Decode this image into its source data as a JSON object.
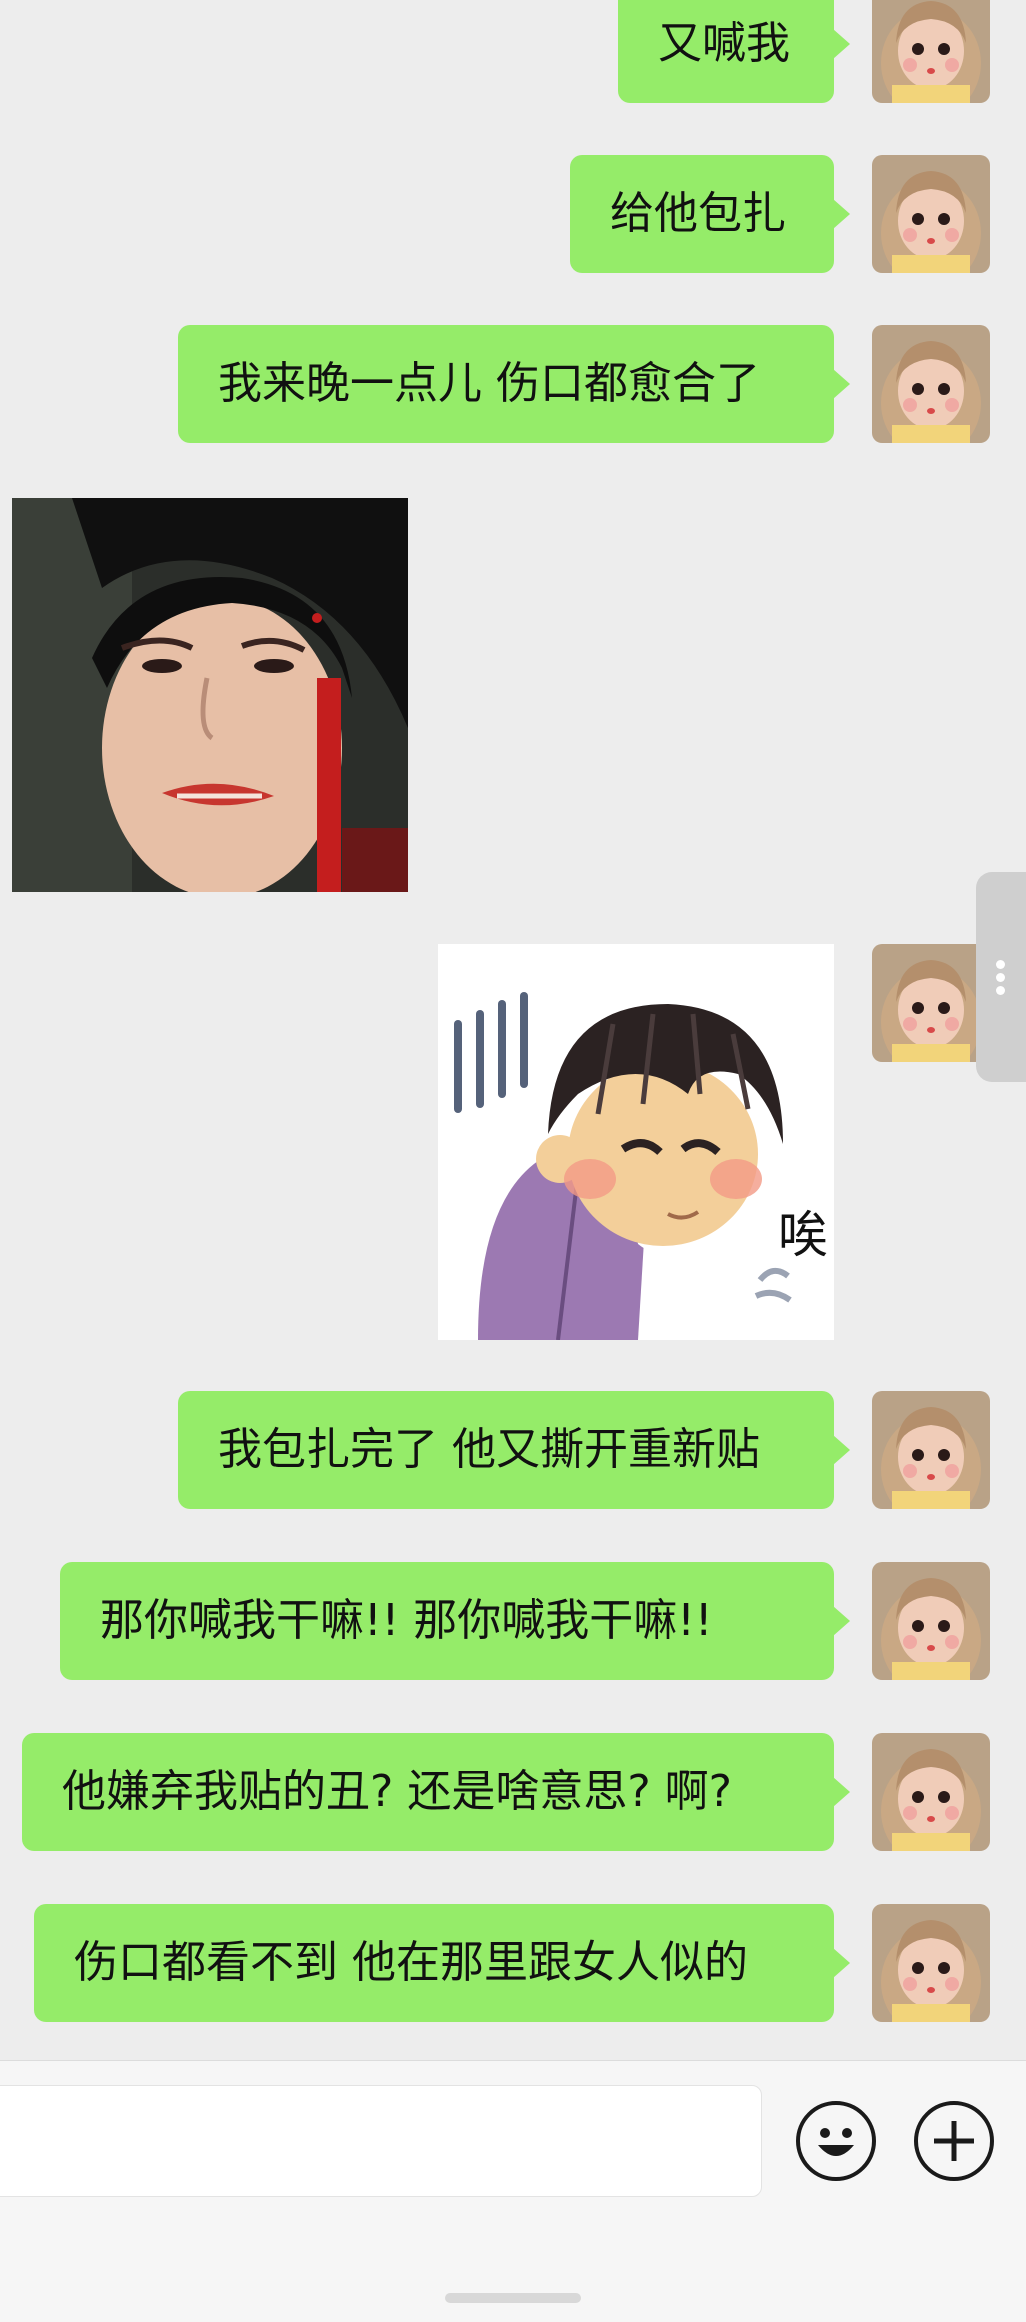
{
  "messages": [
    {
      "text": "又喊我"
    },
    {
      "text": "给他包扎"
    },
    {
      "text": "我来晚一点儿 伤口都愈合了"
    },
    {
      "text": "我包扎完了 他又撕开重新贴"
    },
    {
      "text": "那你喊我干嘛!! 那你喊我干嘛!!"
    },
    {
      "text": "他嫌弃我贴的丑? 还是啥意思? 啊?"
    },
    {
      "text": "伤口都看不到 他在那里跟女人似的"
    }
  ],
  "stickers": {
    "received_photo": {
      "icon": "crying-woman-photo"
    },
    "sent_cartoon": {
      "icon": "sighing-girl-cartoon",
      "caption": "唉"
    }
  },
  "input_bar": {
    "emoji_icon": "smiley-face-icon",
    "plus_icon": "plus-icon"
  },
  "colors": {
    "bubble": "#95ec69",
    "background": "#ededed",
    "input_bar": "#f6f6f6"
  }
}
